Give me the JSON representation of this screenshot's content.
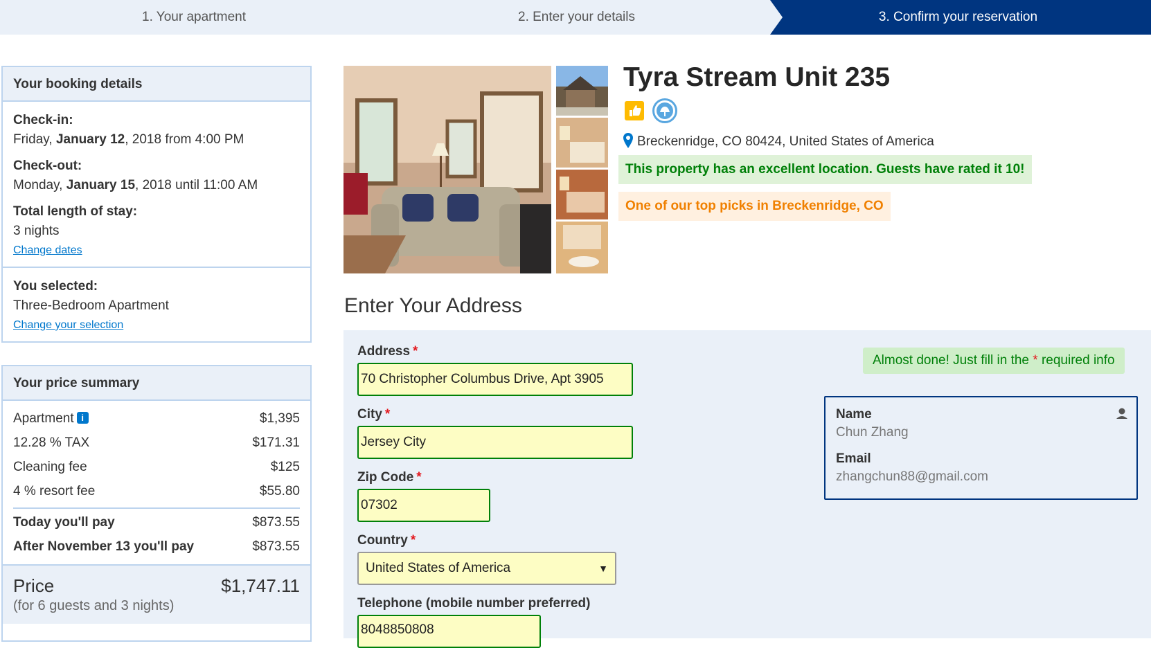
{
  "steps": [
    {
      "label": "1. Your apartment"
    },
    {
      "label": "2. Enter your details"
    },
    {
      "label": "3. Confirm your reservation"
    }
  ],
  "booking": {
    "header": "Your booking details",
    "checkin_label": "Check-in:",
    "checkin_day": "Friday, ",
    "checkin_date": "January 12",
    "checkin_rest": ", 2018 from 4:00 PM",
    "checkout_label": "Check-out:",
    "checkout_day": "Monday, ",
    "checkout_date": "January 15",
    "checkout_rest": ", 2018 until 11:00 AM",
    "length_label": "Total length of stay:",
    "length_value": "3 nights",
    "change_dates": "Change dates",
    "selected_label": "You selected:",
    "selected_value": "Three-Bedroom Apartment",
    "change_selection": "Change your selection"
  },
  "price": {
    "header": "Your price summary",
    "rows": [
      {
        "k": "Apartment",
        "v": "$1,395"
      },
      {
        "k": "12.28 % TAX",
        "v": "$171.31"
      },
      {
        "k": "Cleaning fee",
        "v": "$125"
      },
      {
        "k": "4 % resort fee",
        "v": "$55.80"
      }
    ],
    "today_label": "Today you'll pay",
    "today_value": "$873.55",
    "after_label": "After November 13 you'll pay",
    "after_value": "$873.55",
    "total_label": "Price",
    "total_value": "$1,747.11",
    "total_sub": "(for 6 guests and 3 nights)"
  },
  "property": {
    "title": "Tyra Stream Unit 235",
    "address": "Breckenridge, CO 80424, United States of America",
    "location_banner": "This property has an excellent location. Guests have rated it 10!",
    "pick_banner": "One of our top picks in Breckenridge, CO"
  },
  "form": {
    "title": "Enter Your Address",
    "address_label": "Address",
    "address_value": "70 Christopher Columbus Drive, Apt 3905",
    "city_label": "City",
    "city_value": "Jersey City",
    "zip_label": "Zip Code",
    "zip_value": "07302",
    "country_label": "Country",
    "country_value": "United States of America",
    "phone_label": "Telephone (mobile number preferred)",
    "phone_value": "8048850808",
    "required_mark": "*",
    "almost_pre": "Almost done! Just fill in the ",
    "almost_post": " required info"
  },
  "user": {
    "name_label": "Name",
    "name_value": "Chun Zhang",
    "email_label": "Email",
    "email_value": "zhangchun88@gmail.com"
  },
  "colors": {
    "brand": "#003580",
    "link": "#0077cc",
    "success": "#008009",
    "highlight": "#febb02"
  }
}
